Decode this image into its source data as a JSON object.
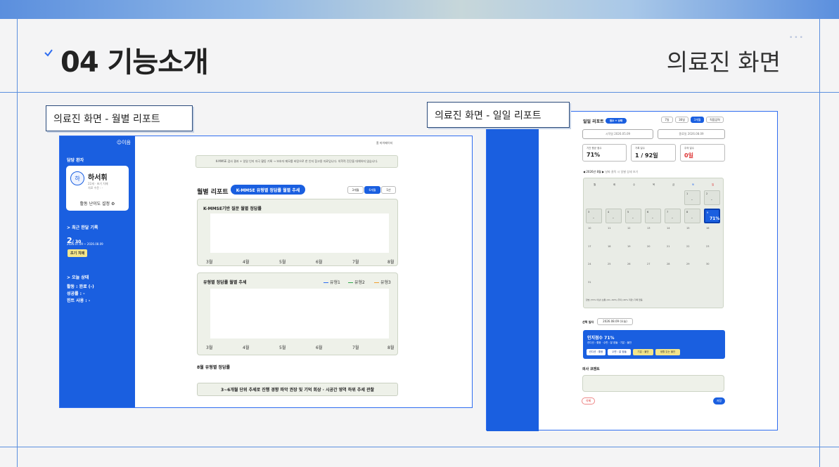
{
  "header": {
    "section_number": "04",
    "section_title": "기능소개",
    "subject": "의료진 화면",
    "dots": "•••"
  },
  "callouts": {
    "monthly": "의료진 화면 - 월별 리포트",
    "daily": "의료진 화면 - 일일 리포트"
  },
  "monthly_report": {
    "logo": "☺이음",
    "sidebar": {
      "patient_label": "담당 환자",
      "avatar": "하",
      "patient_name": "하서휘",
      "patient_info": "22세 · 초기 치매",
      "patient_info2": "치료 수준 : -",
      "difficulty": "활동 난이도 설정 ⚙",
      "recent_label": "> 최근 한달 기록",
      "count_main": "2",
      "count_sub": "/ 30",
      "date_range": "2026.07.09 ~ 2026.08.09",
      "stage_badge": "초기 치매",
      "today_label": "> 오늘 상태",
      "activity": "활동 : 완료 (-)",
      "success": "성공률 : -",
      "hint": "힌트 사용 : -"
    },
    "crumb": "홈   마이페이지",
    "notice": "K-MMSE 검사 결과 + 일일 인지 자극 활동 기록 → 보호자 메모를 바탕으로 한 인지 참고용 자료입니다. 의학적 진단을 대체하지 않습니다.",
    "title": "월별 리포트",
    "title_pill": "K-MMSE 유형별 정답률 월별 추세",
    "range_toggle": [
      "3개월",
      "6개월",
      "1년"
    ],
    "range_selected": "6개월",
    "panel1_title": "K-MMSE기반 질문 월별 정답률",
    "panel2_title": "유형별 정답률 월별 추세",
    "months": [
      "3월",
      "4월",
      "5월",
      "6월",
      "7월",
      "8월"
    ],
    "legend": [
      {
        "name": "유형1",
        "color": "#2f6df0"
      },
      {
        "name": "유형2",
        "color": "#2ea84b"
      },
      {
        "name": "유형3",
        "color": "#f0a030"
      }
    ],
    "subheading": "8월 유형별 정답률",
    "banner": "3~6개월 단위 추세로 진행 경향 파악 권장 및 기억 회상 · 시공간 영역 하위 추세 관찰"
  },
  "daily_report": {
    "title": "일일 리포트",
    "title_badge": "점수 + 상태",
    "periods": [
      "7일",
      "30일",
      "3개월",
      "직접입력"
    ],
    "period_selected": "3개월",
    "start_date": "시작일 2026.05.09",
    "end_date": "종료일 2026.08.09",
    "stats": [
      {
        "label": "기간 평균 점수",
        "value": "71%"
      },
      {
        "label": "기록 일수",
        "value": "1 / 92일"
      },
      {
        "label": "주의 일수",
        "value": "0일"
      }
    ],
    "month_nav": "2026년 8월",
    "month_hint": "날짜 클릭 시 일별 상세 보기",
    "weekdays": [
      "월",
      "화",
      "수",
      "목",
      "금",
      "토",
      "일"
    ],
    "selected_score": "71%",
    "legend_text": "양호 (70% 이상)   보통 (40~69%)   주의 (40% 미만)   기록 없음",
    "selected_label": "선택 일자",
    "selected_date": "2026.08.09 (오늘)",
    "card_title": "인지점수 71%",
    "card_sub": "컨디션 : 좋음 · 수면 : 잘 잠듦 · 기분 : 불안",
    "chips": [
      "컨디션 : 좋음",
      "수면 : 잘 잠듦",
      "기분 : 불안",
      "생활 있는 불안"
    ],
    "comment_label": "의사 코멘트",
    "delete": "삭제",
    "save": "저장"
  }
}
